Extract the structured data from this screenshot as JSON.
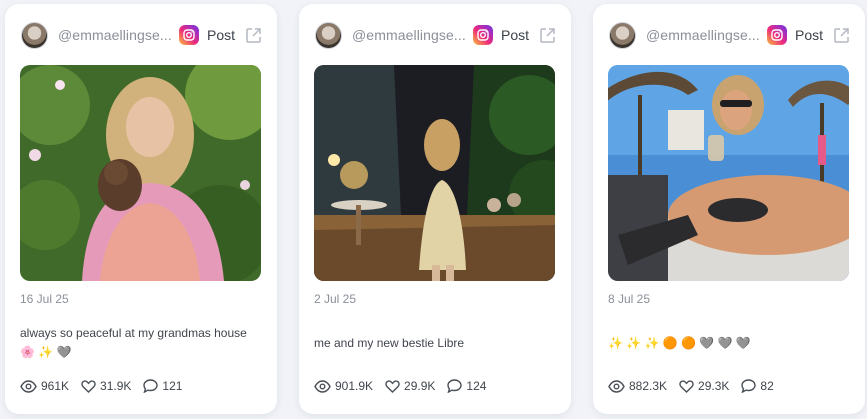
{
  "accent_color": "#e1306c",
  "cards": [
    {
      "handle": "@emmaellingse...",
      "platform_icon": "instagram-icon",
      "post_label": "Post",
      "external_icon": "external-link-icon",
      "date": "16 Jul 25",
      "caption": "always so peaceful at my grandmas house 🌸 ✨ 🩶",
      "views": "961K",
      "likes": "31.9K",
      "comments": "121"
    },
    {
      "handle": "@emmaellingse...",
      "platform_icon": "instagram-icon",
      "post_label": "Post",
      "external_icon": "external-link-icon",
      "date": "2 Jul 25",
      "caption": "me and my new bestie Libre",
      "views": "901.9K",
      "likes": "29.9K",
      "comments": "124"
    },
    {
      "handle": "@emmaellingse...",
      "platform_icon": "instagram-icon",
      "post_label": "Post",
      "external_icon": "external-link-icon",
      "date": "8 Jul 25",
      "caption": "✨ ✨ ✨ 🟠 🟠 🩶 🩶 🩶",
      "views": "882.3K",
      "likes": "29.3K",
      "comments": "82"
    }
  ]
}
